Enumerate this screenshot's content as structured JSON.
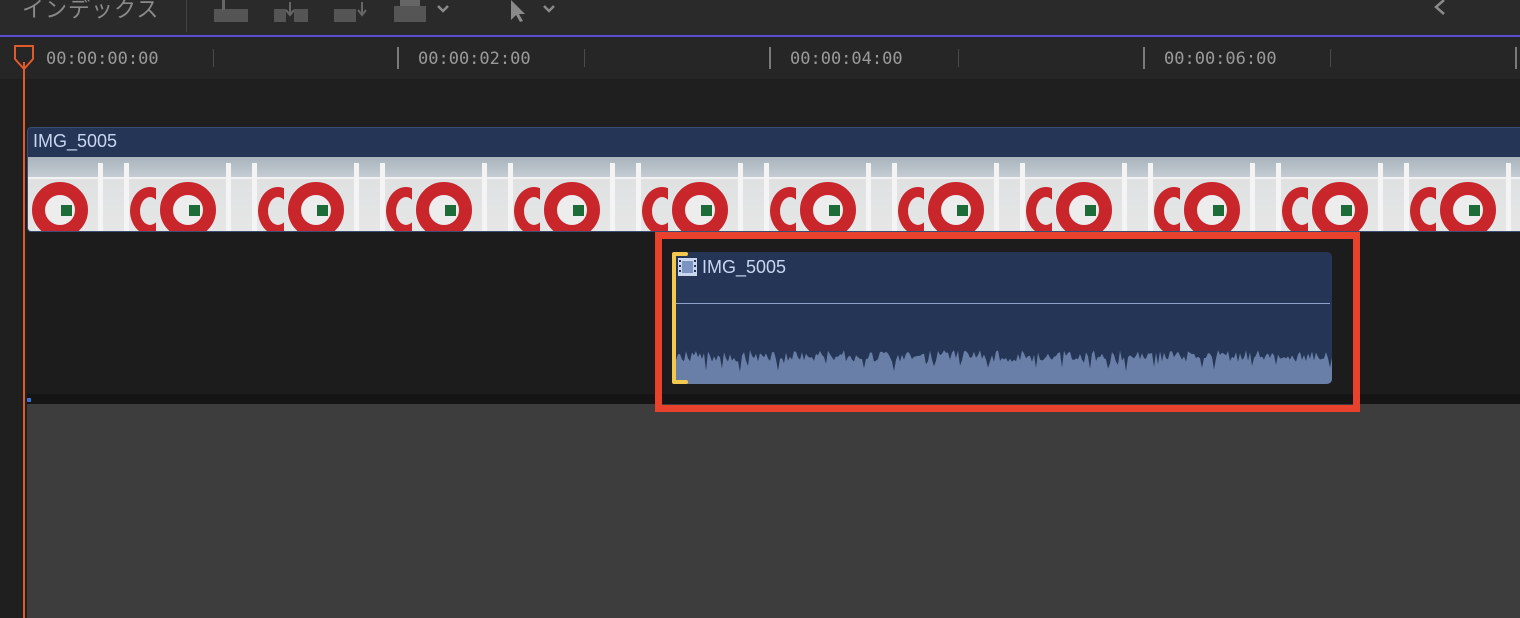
{
  "toolbar": {
    "index_label": "インデックス",
    "icons": [
      "connect-clip-icon",
      "insert-clip-icon",
      "append-clip-icon",
      "overwrite-clip-icon",
      "select-tool-icon",
      "nav-back-icon"
    ]
  },
  "ruler": {
    "timecodes": [
      "00:00:00:00",
      "00:00:02:00",
      "00:00:04:00",
      "00:00:06:00"
    ]
  },
  "primary_clip": {
    "name": "IMG_5005"
  },
  "connected_clip": {
    "name": "IMG_5005"
  },
  "colors": {
    "playhead": "#e05a2b",
    "highlight": "#e8412c",
    "clip_selected_edge": "#f2c94c",
    "clip_body": "#243555",
    "audio_wave": "#6a7fa7"
  }
}
